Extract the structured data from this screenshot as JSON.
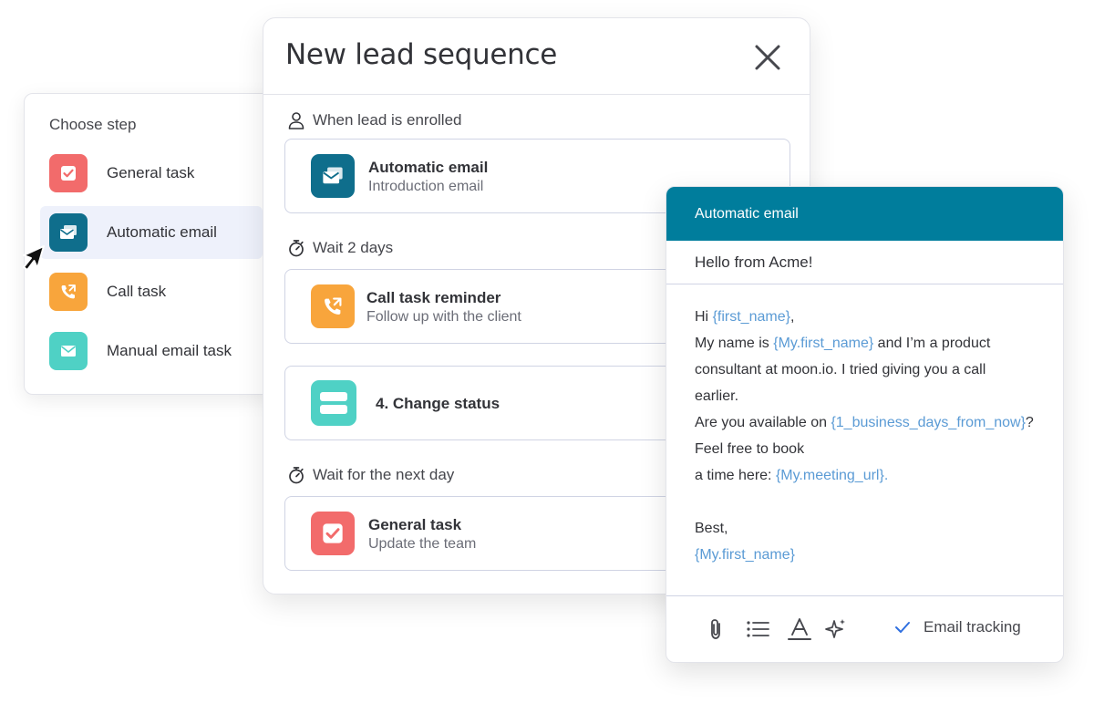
{
  "choose_step": {
    "title": "Choose step",
    "items": [
      {
        "label": "General task",
        "icon": "checkbox-icon",
        "color": "#f26b6b"
      },
      {
        "label": "Automatic email",
        "icon": "email-stack-icon",
        "color": "#0f6e8c"
      },
      {
        "label": "Call task",
        "icon": "phone-icon",
        "color": "#f8a53c"
      },
      {
        "label": "Manual email task",
        "icon": "envelope-icon",
        "color": "#4fd1c5"
      }
    ],
    "active_index": 1
  },
  "sequence": {
    "title": "New lead sequence",
    "groups": [
      {
        "label": "When lead is enrolled",
        "label_icon": "person-icon",
        "card": {
          "title": "Automatic email",
          "subtitle": "Introduction email",
          "icon": "email-stack-icon",
          "color": "#0f6e8c"
        }
      },
      {
        "label": "Wait 2 days",
        "label_icon": "stopwatch-icon",
        "card": {
          "title": "Call task reminder",
          "subtitle": "Follow up with the client",
          "icon": "phone-icon",
          "color": "#f8a53c"
        }
      },
      {
        "card": {
          "title": "4. Change status",
          "icon": "status-icon",
          "color": "#4fd1c5"
        }
      },
      {
        "label": "Wait for the next day",
        "label_icon": "stopwatch-icon",
        "card": {
          "title": "General task",
          "subtitle": "Update the team",
          "icon": "checkbox-icon",
          "color": "#f26b6b"
        }
      }
    ]
  },
  "email": {
    "header": "Automatic email",
    "subject": "Hello from Acme!",
    "body": {
      "greeting": "Hi ",
      "var_first_name": "{first_name}",
      "comma": ",",
      "l2_a": "My name is ",
      "var_my_first_name": "{My.first_name}",
      "l2_b": " and I’m a product",
      "l3": "consultant at moon.io. I tried giving you a call",
      "l4": "earlier.",
      "l5_a": "Are you available on ",
      "var_days": "{1_business_days_from_now}",
      "l5_b": "?",
      "l6": "Feel free to book",
      "l7_a": "a time here: ",
      "var_meeting": "{My.meeting_url}.",
      "sign_off": "Best,",
      "signature": "{My.first_name}"
    },
    "toolbar": {
      "tools": [
        "paperclip-icon",
        "list-icon",
        "text-format-icon",
        "sparkle-icon"
      ],
      "tracking_label": "Email tracking",
      "tracking_checked": true
    }
  },
  "colors": {
    "accent": "#007d9c",
    "variable": "#5b9bd5"
  }
}
